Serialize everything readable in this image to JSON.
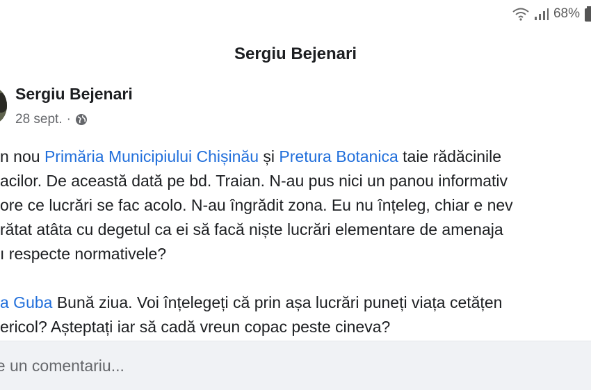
{
  "status": {
    "battery": "68%"
  },
  "header": {
    "title": "Sergiu Bejenari"
  },
  "post": {
    "author": "Sergiu Bejenari",
    "date": "28 sept.",
    "separator": "·",
    "lines": {
      "l1_a": "n nou ",
      "l1_m1": "Primăria Municipiului Chișinău",
      "l1_b": " și ",
      "l1_m2": "Pretura Botanica",
      "l1_c": " taie rădăcinile",
      "l2": "acilor. De această dată pe bd. Traian. N-au pus nici un panou informativ",
      "l3": "ore ce lucrări se fac acolo. N-au îngrădit zona. Eu nu înțeleg, chiar e nev",
      "l4": "rătat atâta cu degetul ca ei să facă niște lucrări elementare de amenaja",
      "l5": "ı respecte normativele?",
      "l6_m": "a  Guba",
      "l6_b": " Bună ziua. Voi înțelegeți că prin așa lucrări puneți viața cetățen",
      "l7": "ericol? Așteptați iar să cadă vreun copac peste cineva?"
    }
  },
  "comment": {
    "placeholder": "rie un comentariu..."
  },
  "colors": {
    "mention": "#216fdb",
    "comment_bar": "#f0f2f5"
  }
}
